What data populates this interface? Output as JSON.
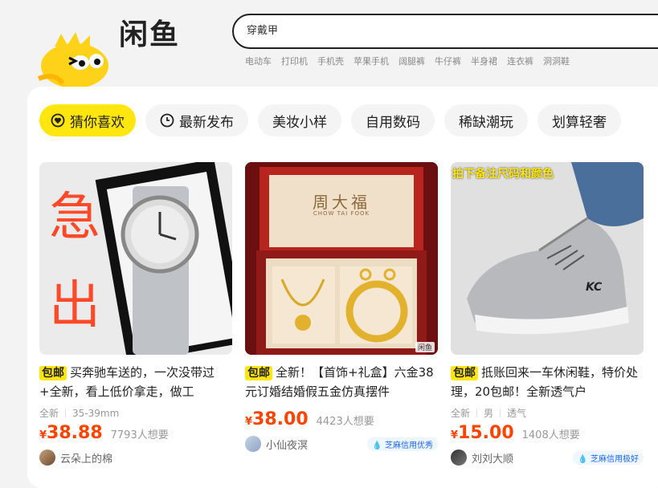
{
  "header": {
    "logo_text": "闲鱼",
    "search_value": "穿戴甲",
    "hot_words": [
      "电动车",
      "打印机",
      "手机壳",
      "苹果手机",
      "阔腿裤",
      "牛仔裤",
      "半身裙",
      "连衣裤",
      "洞洞鞋"
    ]
  },
  "tabs": [
    {
      "label": "猜你喜欢",
      "active": true,
      "icon": "heart-circle-icon"
    },
    {
      "label": "最新发布",
      "active": false,
      "icon": "clock-icon"
    },
    {
      "label": "美妆小样",
      "active": false
    },
    {
      "label": "自用数码",
      "active": false
    },
    {
      "label": "稀缺潮玩",
      "active": false
    },
    {
      "label": "划算轻奢",
      "active": false
    }
  ],
  "cards": [
    {
      "badge": "包邮",
      "title": "买奔驰车送的，一次没带过+全新，看上低价拿走，做工",
      "tags": [
        "全新",
        "35-39mm"
      ],
      "price_symbol": "¥",
      "price": "38.88",
      "want": "7793人想要",
      "seller": "云朵上的棉",
      "credit": "",
      "image_overlay": "急出"
    },
    {
      "badge": "包邮",
      "title": "全新！【首饰+礼盒】六金38元订婚结婚假五金仿真摆件",
      "tags": [],
      "price_symbol": "¥",
      "price": "38.00",
      "want": "4423人想要",
      "seller": "小仙夜溟",
      "credit": "芝麻信用优秀",
      "image_overlay": "周大福",
      "image_subtext": "CHOW TAI FOOK",
      "image_watermark": "闲鱼"
    },
    {
      "badge": "包邮",
      "title": "抵账回来一车休闲鞋，特价处理，20包邮！全新透气户",
      "tags": [
        "全新",
        "男",
        "透气"
      ],
      "price_symbol": "¥",
      "price": "15.00",
      "want": "1408人想要",
      "seller": "刘刘大顺",
      "credit": "芝麻信用极好",
      "image_overlay": "拍下备注尺码和颜色",
      "shoe_brand": "KC"
    }
  ],
  "colors": {
    "accent": "#ffe60f",
    "price": "#ff4400",
    "credit": "#1a66ff"
  }
}
